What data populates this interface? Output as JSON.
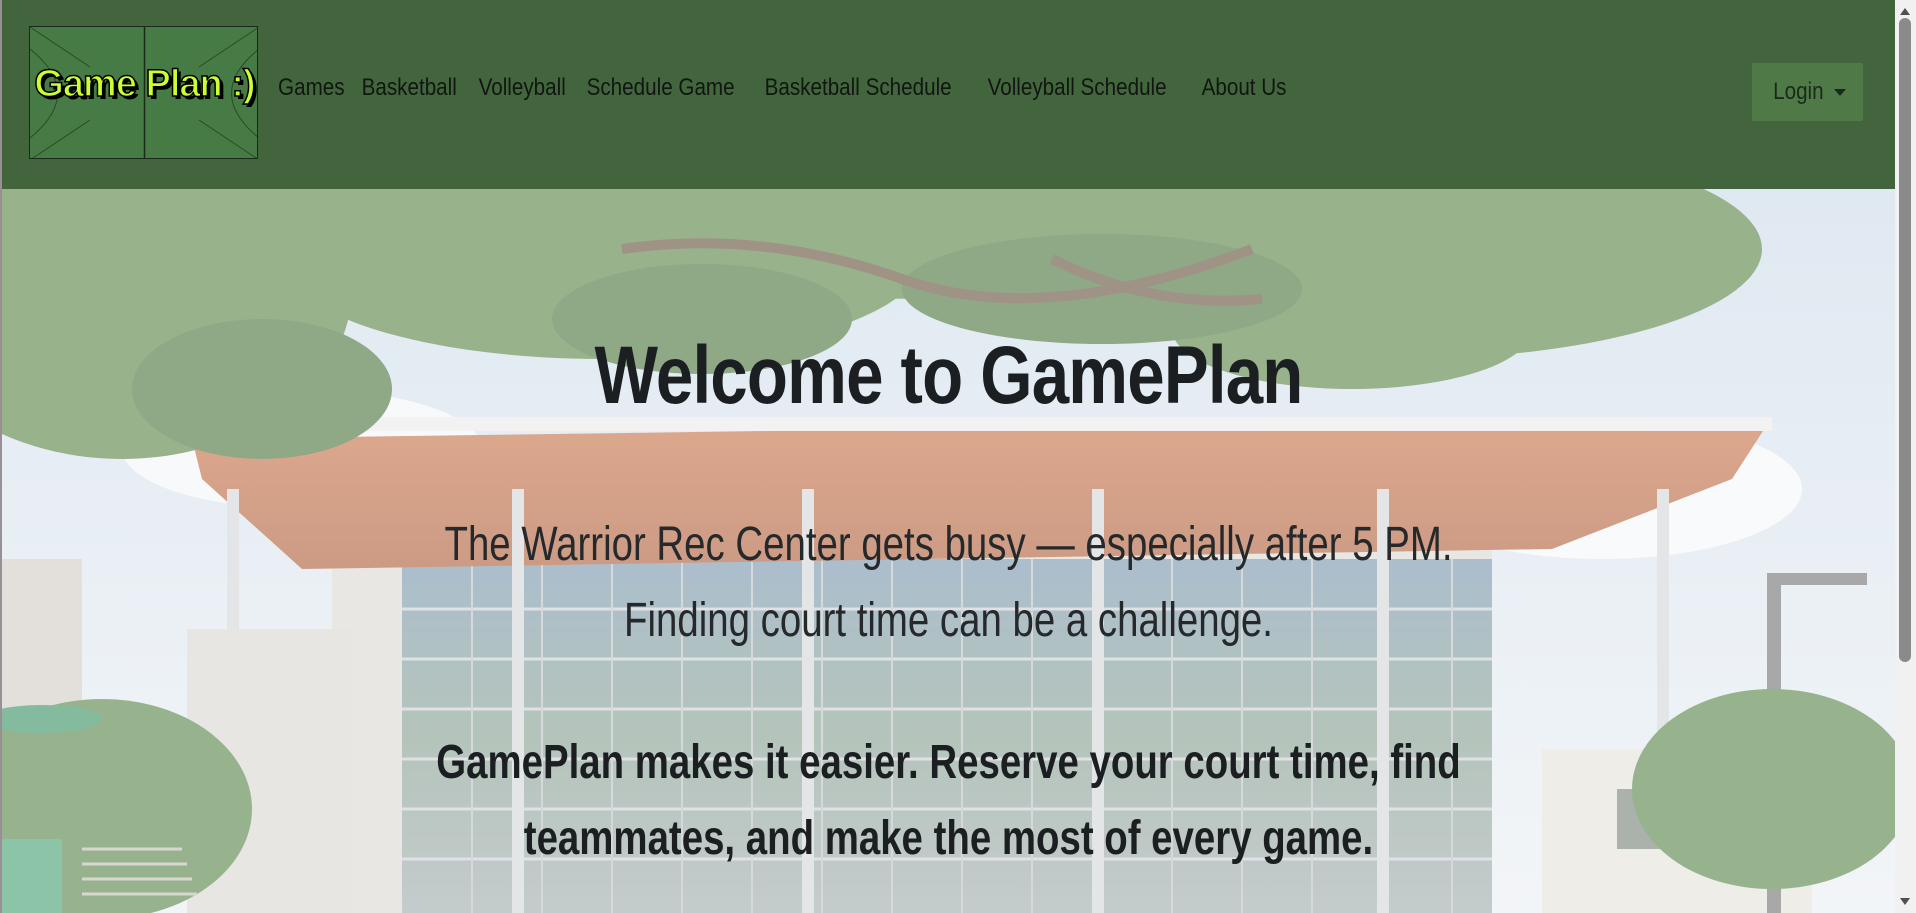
{
  "navbar": {
    "logo_text": "Game Plan :)",
    "links": [
      {
        "label": "Games"
      },
      {
        "label": "Basketball"
      },
      {
        "label": "Volleyball"
      },
      {
        "label": "Schedule Game"
      },
      {
        "label": "Basketball Schedule"
      },
      {
        "label": "Volleyball Schedule"
      },
      {
        "label": "About Us"
      }
    ],
    "login_label": "Login",
    "background_color": "#42653d",
    "logo_text_color": "#ccff33"
  },
  "hero": {
    "title": "Welcome to GamePlan",
    "paragraph_1": "The Warrior Rec Center gets busy — especially after 5 PM. Finding court time can be a challenge.",
    "paragraph_2": "GamePlan makes it easier. Reserve your court time, find teammates, and make the most of every game."
  },
  "icons": {
    "login_caret": "chevron-down-icon"
  }
}
